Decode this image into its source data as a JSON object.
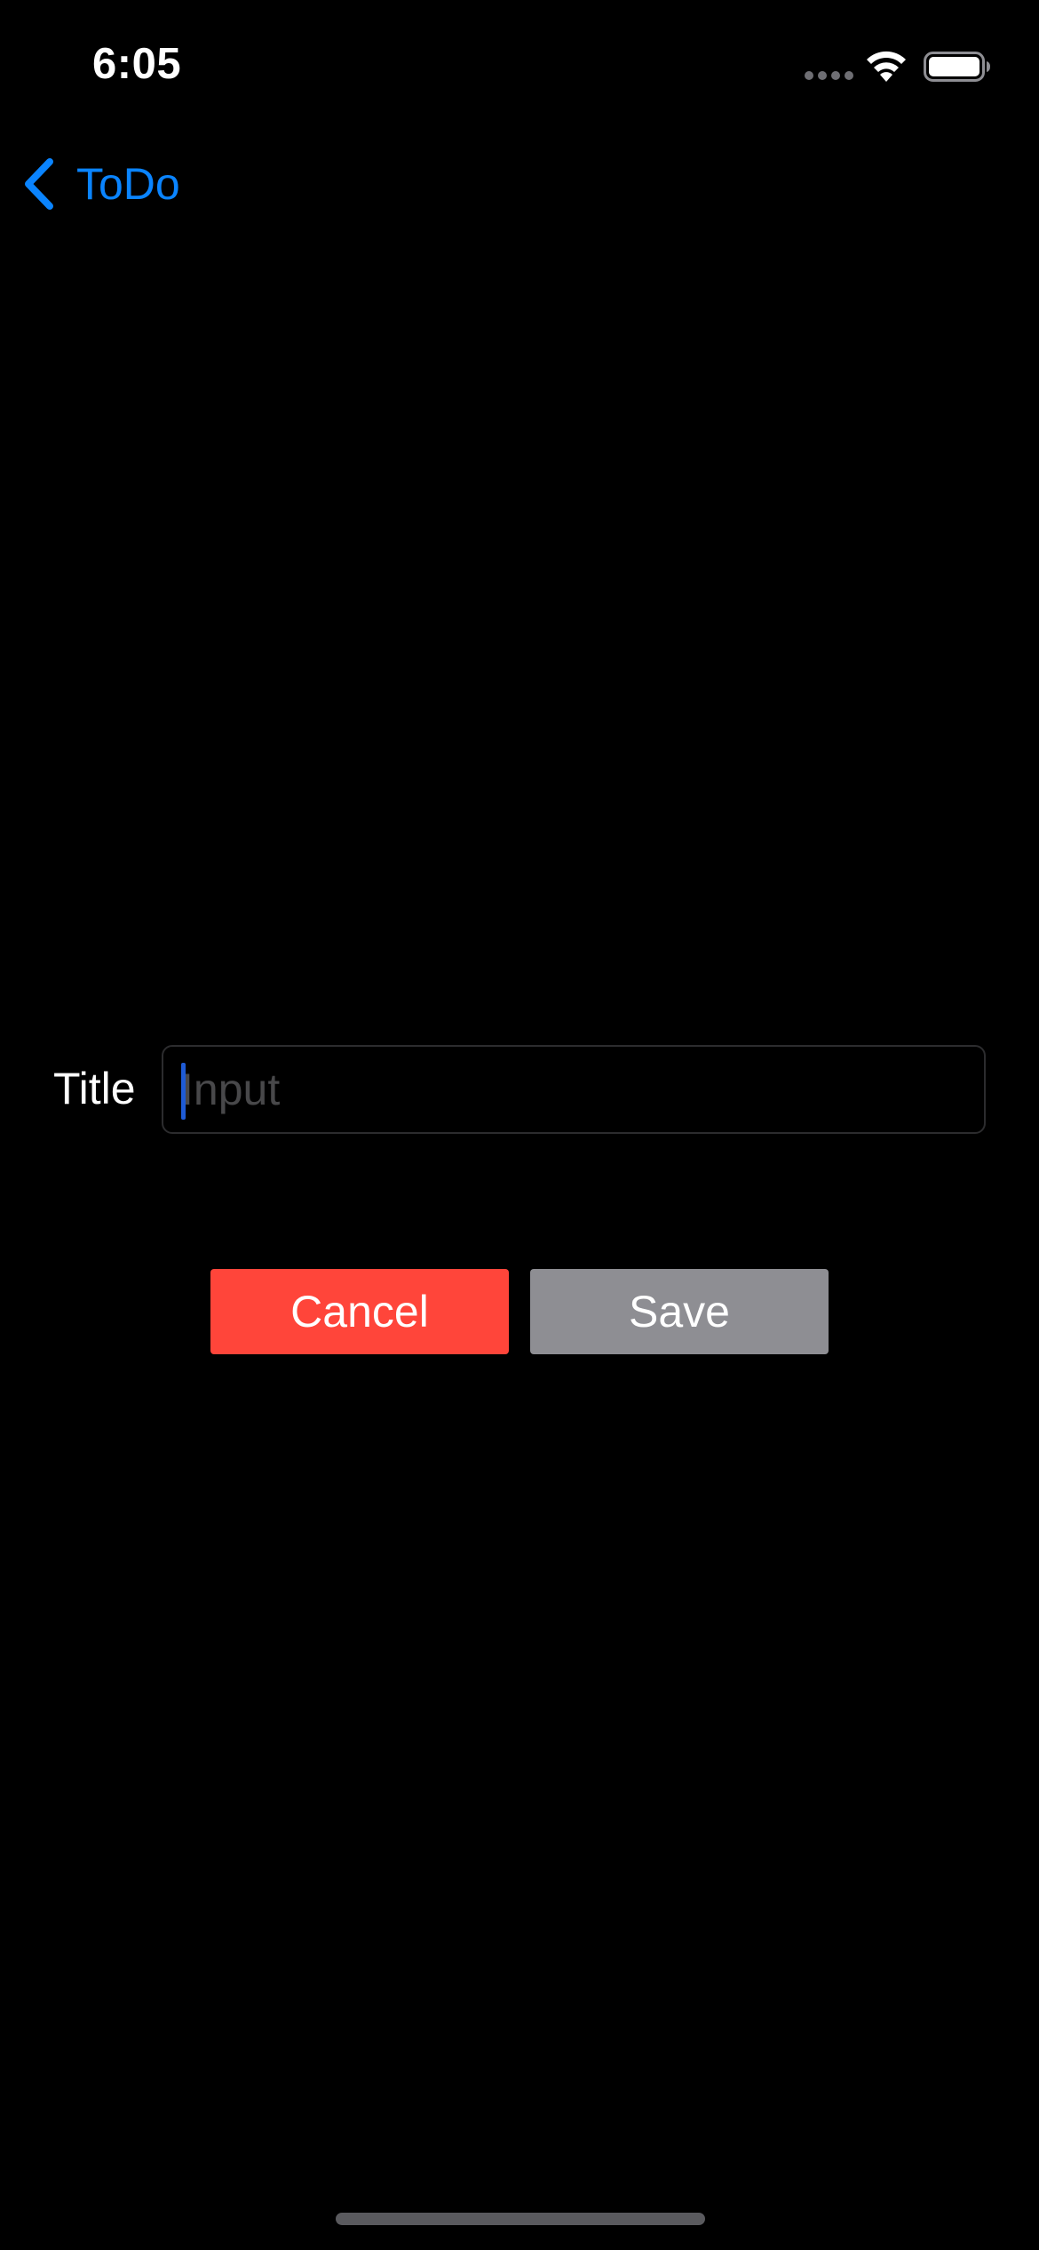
{
  "status_bar": {
    "time": "6:05",
    "signal_icon": "cellular-dots-icon",
    "wifi_icon": "wifi-icon",
    "battery_icon": "battery-full-icon"
  },
  "nav": {
    "back_label": "ToDo",
    "back_icon": "chevron-left-icon"
  },
  "form": {
    "title_label": "Title",
    "title_input": {
      "value": "",
      "placeholder": "Input"
    }
  },
  "actions": {
    "cancel_label": "Cancel",
    "save_label": "Save"
  },
  "colors": {
    "background": "#000000",
    "accent": "#0a84ff",
    "cancel": "#ff453a",
    "save": "#8e8e93"
  }
}
